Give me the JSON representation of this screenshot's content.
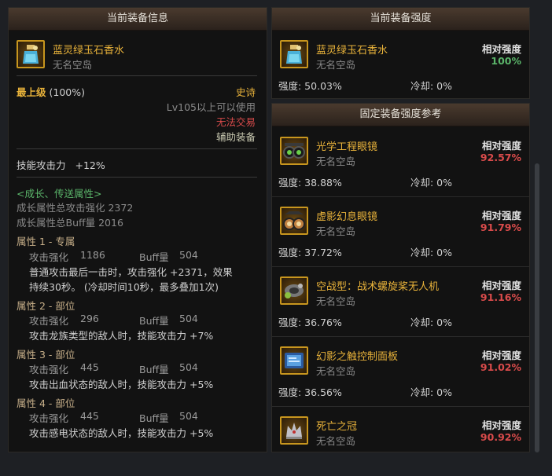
{
  "left": {
    "header": "当前装备信息",
    "item": {
      "name": "蓝灵绿玉石香水",
      "source": "无名空岛",
      "icon": "perfume-icon"
    },
    "grade": "最上级",
    "grade_pct": "(100%)",
    "rarity": "史诗",
    "level_req": "Lv105以上可以使用",
    "trade": "无法交易",
    "type": "辅助装备",
    "skill_atk_label": "技能攻击力",
    "skill_atk_value": "+12%",
    "growth_title": "<成长、传送属性>",
    "growth_atk": "成长属性总攻击强化 2372",
    "growth_buff": "成长属性总Buff量 2016",
    "attrs": [
      {
        "title": "属性 1 - 专属",
        "atk_label": "攻击强化",
        "atk": "1186",
        "buff_label": "Buff量",
        "buff": "504",
        "desc1": "普通攻击最后一击时，攻击强化 +2371，效果",
        "desc2": "持续30秒。 (冷却时间10秒，最多叠加1次)"
      },
      {
        "title": "属性 2 - 部位",
        "atk_label": "攻击强化",
        "atk": "296",
        "buff_label": "Buff量",
        "buff": "504",
        "desc1": "攻击龙族类型的敌人时，技能攻击力 +7%"
      },
      {
        "title": "属性 3 - 部位",
        "atk_label": "攻击强化",
        "atk": "445",
        "buff_label": "Buff量",
        "buff": "504",
        "desc1": "攻击出血状态的敌人时，技能攻击力 +5%"
      },
      {
        "title": "属性 4 - 部位",
        "atk_label": "攻击强化",
        "atk": "445",
        "buff_label": "Buff量",
        "buff": "504",
        "desc1": "攻击感电状态的敌人时，技能攻击力 +5%"
      }
    ]
  },
  "right_top": {
    "header": "当前装备强度",
    "item": {
      "name": "蓝灵绿玉石香水",
      "source": "无名空岛",
      "icon": "perfume-icon"
    },
    "rel_label": "相对强度",
    "rel_value": "100%",
    "strength": "强度: 50.03%",
    "cooldown": "冷却: 0%"
  },
  "right_bottom": {
    "header": "固定装备强度参考",
    "items": [
      {
        "name": "光学工程眼镜",
        "source": "无名空岛",
        "rel_label": "相对强度",
        "rel_value": "92.57%",
        "strength": "强度: 38.88%",
        "cooldown": "冷却: 0%",
        "icon": "goggles-icon"
      },
      {
        "name": "虚影幻息眼镜",
        "source": "无名空岛",
        "rel_label": "相对强度",
        "rel_value": "91.79%",
        "strength": "强度: 37.72%",
        "cooldown": "冷却: 0%",
        "icon": "glasses-icon"
      },
      {
        "name": "空战型：战术螺旋桨无人机",
        "source": "无名空岛",
        "rel_label": "相对强度",
        "rel_value": "91.16%",
        "strength": "强度: 36.76%",
        "cooldown": "冷却: 0%",
        "icon": "drone-icon"
      },
      {
        "name": "幻影之触控制面板",
        "source": "无名空岛",
        "rel_label": "相对强度",
        "rel_value": "91.02%",
        "strength": "强度: 36.56%",
        "cooldown": "冷却: 0%",
        "icon": "panel-icon"
      },
      {
        "name": "死亡之冠",
        "source": "无名空岛",
        "rel_label": "相对强度",
        "rel_value": "90.92%",
        "icon": "crown-icon"
      }
    ]
  },
  "colors": {
    "gold": "#e8b23a",
    "red": "#d94b4b",
    "green": "#5bb56a",
    "attr": "#c8b08a"
  }
}
